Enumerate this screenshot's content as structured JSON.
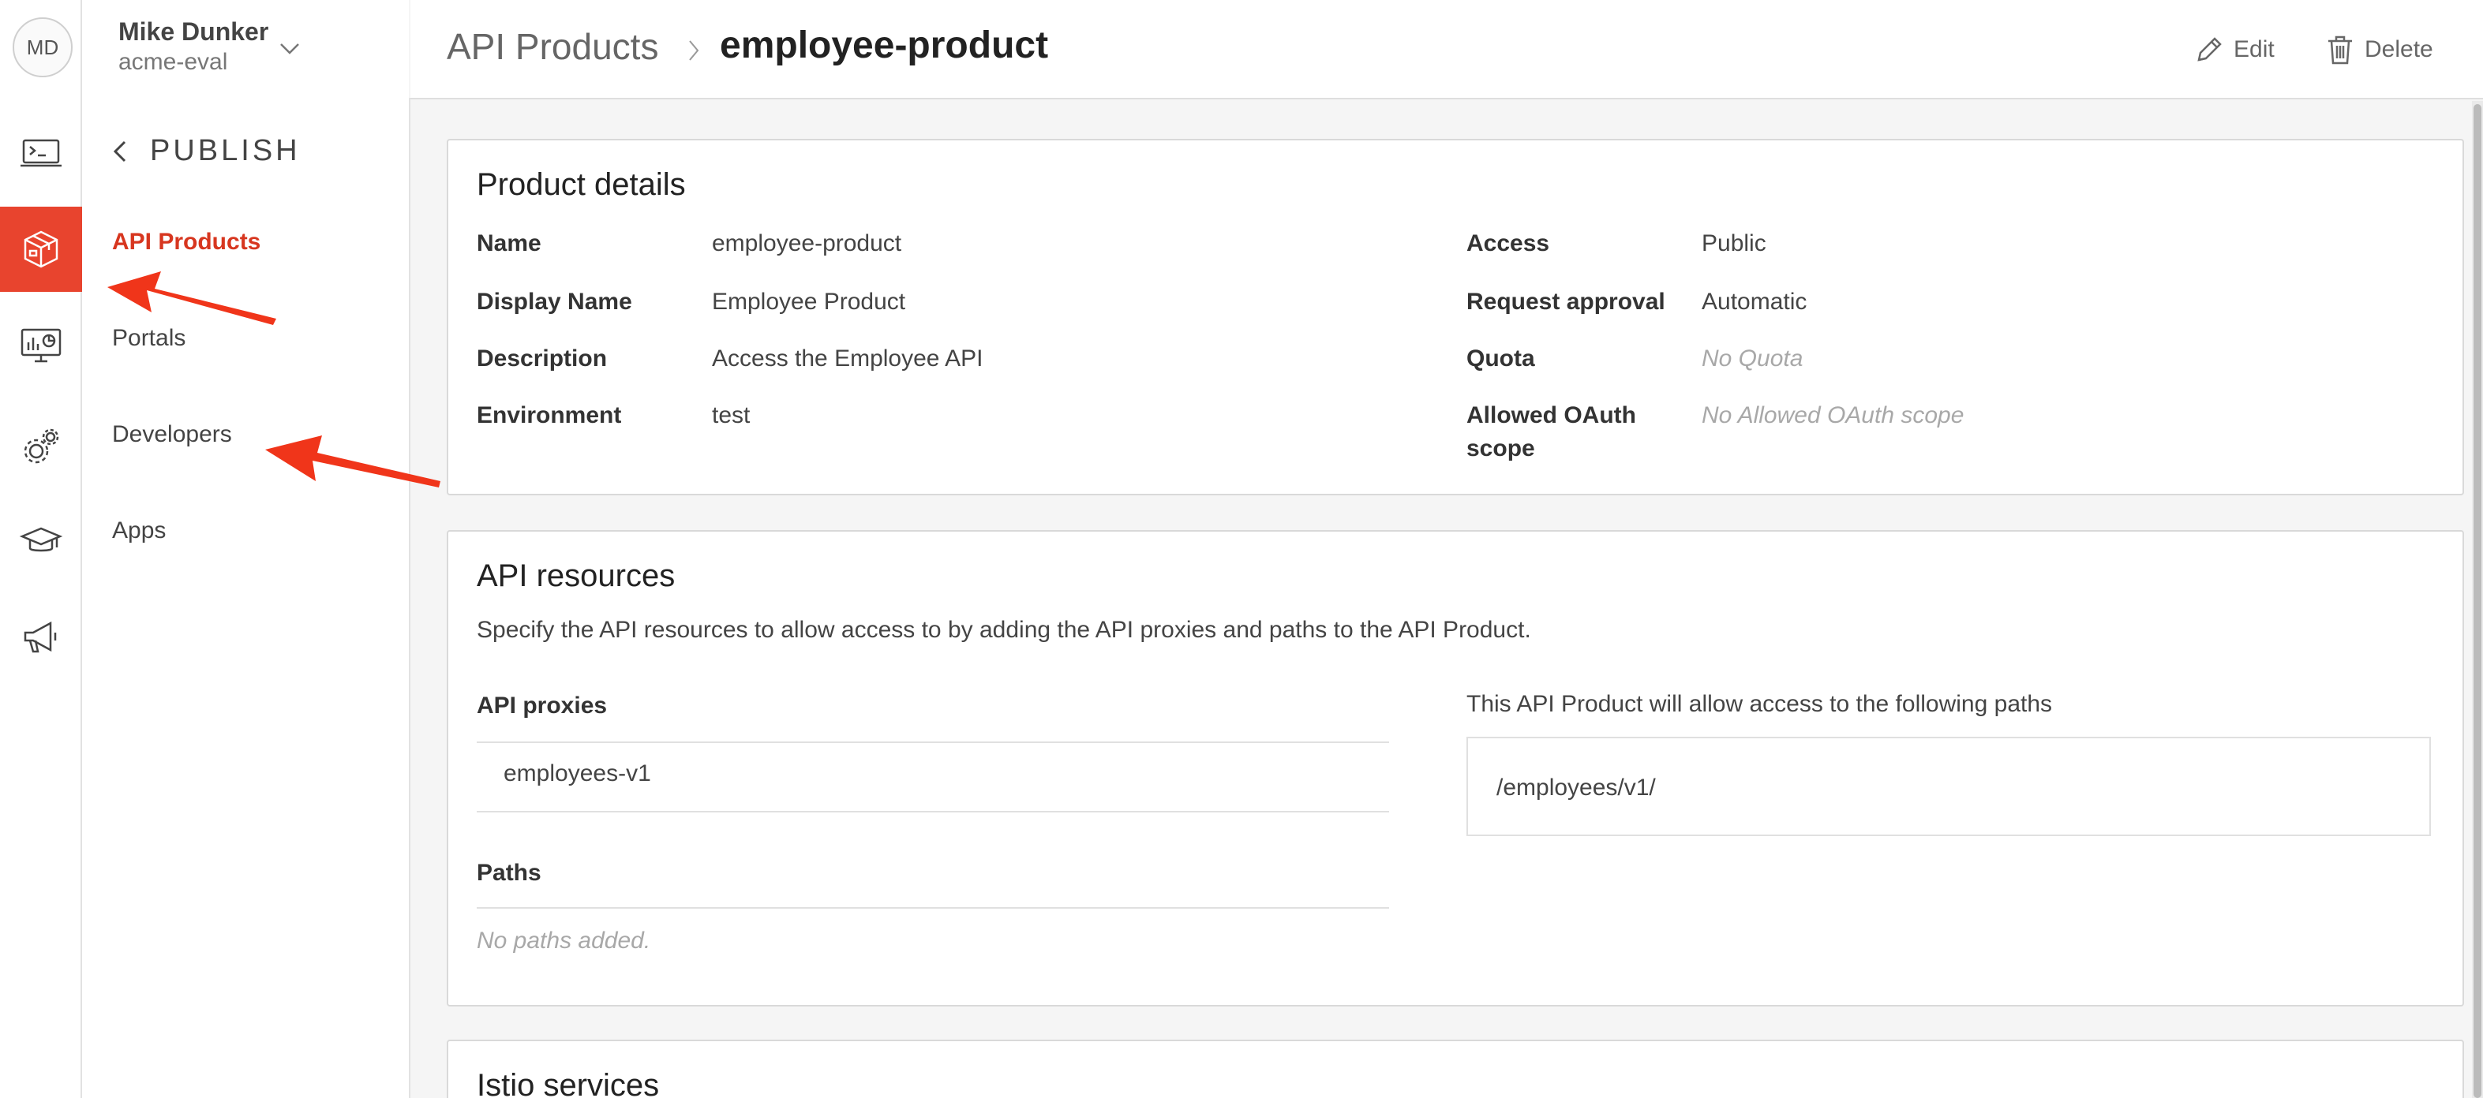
{
  "user": {
    "initials": "MD",
    "name": "Mike Dunker",
    "org": "acme-eval"
  },
  "rail_icons": [
    "terminal-icon",
    "package-icon",
    "monitor-chart-icon",
    "gears-icon",
    "graduation-cap-icon",
    "megaphone-icon"
  ],
  "subnav": {
    "title": "PUBLISH",
    "items": [
      {
        "label": "API Products",
        "active": true
      },
      {
        "label": "Portals",
        "active": false
      },
      {
        "label": "Developers",
        "active": false
      },
      {
        "label": "Apps",
        "active": false
      }
    ]
  },
  "breadcrumb": {
    "root": "API Products",
    "current": "employee-product"
  },
  "actions": {
    "edit": "Edit",
    "delete": "Delete"
  },
  "product_details": {
    "title": "Product details",
    "left": [
      {
        "label": "Name",
        "value": "employee-product",
        "muted": false
      },
      {
        "label": "Display Name",
        "value": "Employee Product",
        "muted": false
      },
      {
        "label": "Description",
        "value": "Access the Employee API",
        "muted": false
      },
      {
        "label": "Environment",
        "value": "test",
        "muted": false
      }
    ],
    "right": [
      {
        "label": "Access",
        "value": "Public",
        "muted": false
      },
      {
        "label": "Request approval",
        "value": "Automatic",
        "muted": false
      },
      {
        "label": "Quota",
        "value": "No Quota",
        "muted": true
      },
      {
        "label": "Allowed OAuth scope",
        "value": "No Allowed OAuth scope",
        "muted": true
      }
    ]
  },
  "api_resources": {
    "title": "API resources",
    "description": "Specify the API resources to allow access to by adding the API proxies and paths to the API Product.",
    "proxies_label": "API proxies",
    "proxies": [
      "employees-v1"
    ],
    "paths_label": "Paths",
    "paths_empty": "No paths added.",
    "allowed_paths_label": "This API Product will allow access to the following paths",
    "allowed_paths": [
      "/employees/v1/"
    ]
  },
  "istio": {
    "title": "Istio services"
  },
  "colors": {
    "accent": "#e8442e",
    "active_text": "#d7361f",
    "annotation_arrow": "#f0351a"
  }
}
